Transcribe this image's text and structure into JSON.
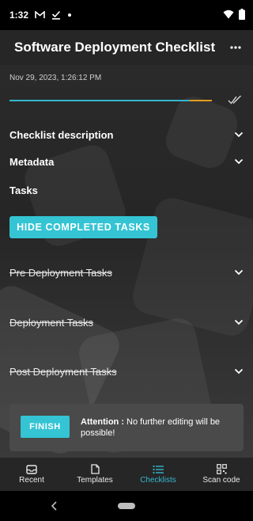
{
  "status": {
    "time": "1:32"
  },
  "app": {
    "title": "Software Deployment Checklist"
  },
  "checklist": {
    "timestamp": "Nov 29, 2023, 1:26:12 PM",
    "progress_fraction": 0.89,
    "sections": {
      "description": "Checklist description",
      "metadata": "Metadata",
      "tasks": "Tasks"
    },
    "hide_completed_label": "HIDE COMPLETED TASKS",
    "task_groups": [
      {
        "label": "Pre Deployment Tasks"
      },
      {
        "label": "Deployment Tasks"
      },
      {
        "label": "Post Deployment Tasks"
      }
    ]
  },
  "finish": {
    "button_label": "FINISH",
    "attention_label": "Attention :",
    "message": "No further editing will be possible!"
  },
  "nav": {
    "items": [
      {
        "label": "Recent",
        "icon": "inbox-icon"
      },
      {
        "label": "Templates",
        "icon": "document-icon"
      },
      {
        "label": "Checklists",
        "icon": "list-icon"
      },
      {
        "label": "Scan code",
        "icon": "qr-code-icon"
      }
    ],
    "active": "Checklists"
  },
  "colors": {
    "accent": "#34c4d4",
    "progress_remaining": "#e69b1e"
  }
}
